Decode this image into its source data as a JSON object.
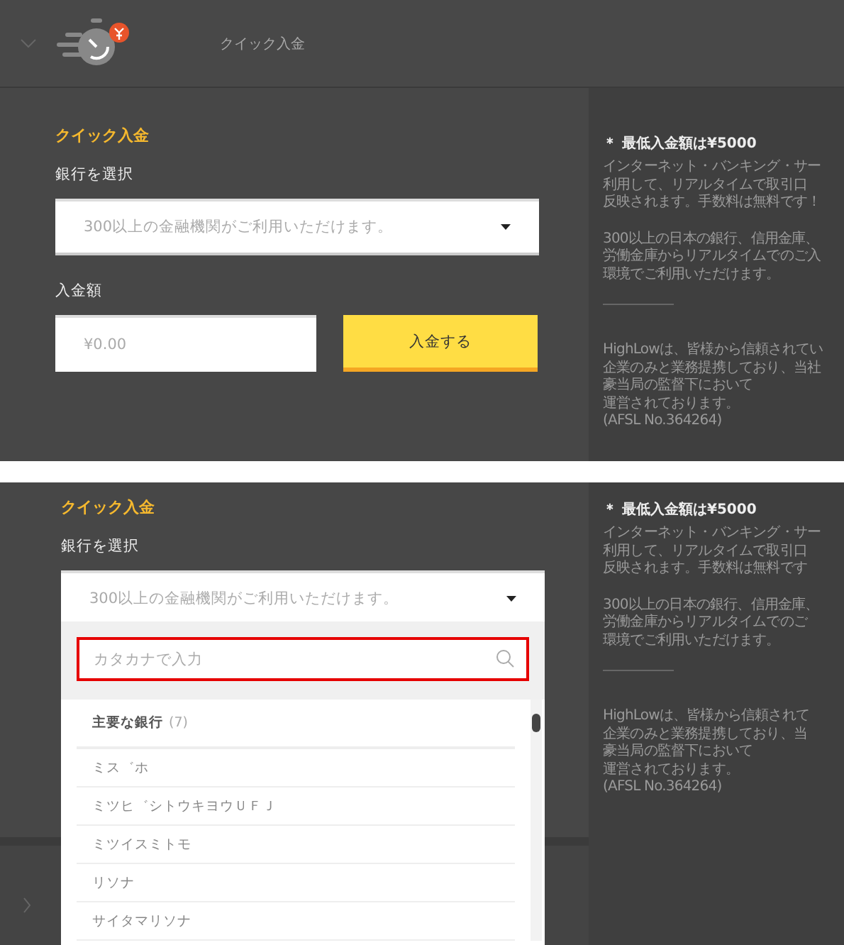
{
  "header": {
    "title": "クイック入金"
  },
  "top": {
    "form": {
      "title": "クイック入金",
      "bank_label": "銀行を選択",
      "bank_placeholder": "300以上の金融機関がご利用いただけます。",
      "amount_label": "入金額",
      "amount_placeholder": "¥0.00",
      "submit": "入金する"
    },
    "info": {
      "minimum": "＊ 最低入金額は¥5000",
      "paragraphs": [
        [
          "インターネット・バンキング・サー",
          "利用して、リアルタイムで取引口",
          "反映されます。手数料は無料です！"
        ],
        [
          "300以上の日本の銀行、信用金庫、",
          "労働金庫からリアルタイムでのご入",
          "環境でご利用いただけます。"
        ],
        [
          "HighLowは、皆様から信頼されてい",
          "企業のみと業務提携しており、当社",
          "豪当局の監督下において",
          "運営されております。",
          "(AFSL No.364264)"
        ]
      ]
    }
  },
  "bottom": {
    "form": {
      "title": "クイック入金",
      "bank_label": "銀行を選択",
      "bank_placeholder": "300以上の金融機関がご利用いただけます。"
    },
    "dropdown": {
      "search_placeholder": "カタカナで入力",
      "group": {
        "label": "主要な銀行",
        "count": "(7)"
      },
      "items": [
        "ミス゛ホ",
        "ミツヒ゛シトウキヨウＵＦＪ",
        "ミツイスミトモ",
        "リソナ",
        "サイタマリソナ"
      ]
    },
    "info": {
      "minimum": "＊ 最低入金額は¥5000",
      "paragraphs": [
        [
          "インターネット・バンキング・サー",
          "利用して、リアルタイムで取引口",
          "反映されます。手数料は無料です"
        ],
        [
          "300以上の日本の銀行、信用金庫、",
          "労働金庫からリアルタイムでのご",
          "環境でご利用いただけます。"
        ],
        [
          "HighLowは、皆様から信頼されて",
          "企業のみと業務提携しており、当",
          "豪当局の監督下において",
          "運営されております。",
          "(AFSL No.364264)"
        ]
      ]
    }
  }
}
